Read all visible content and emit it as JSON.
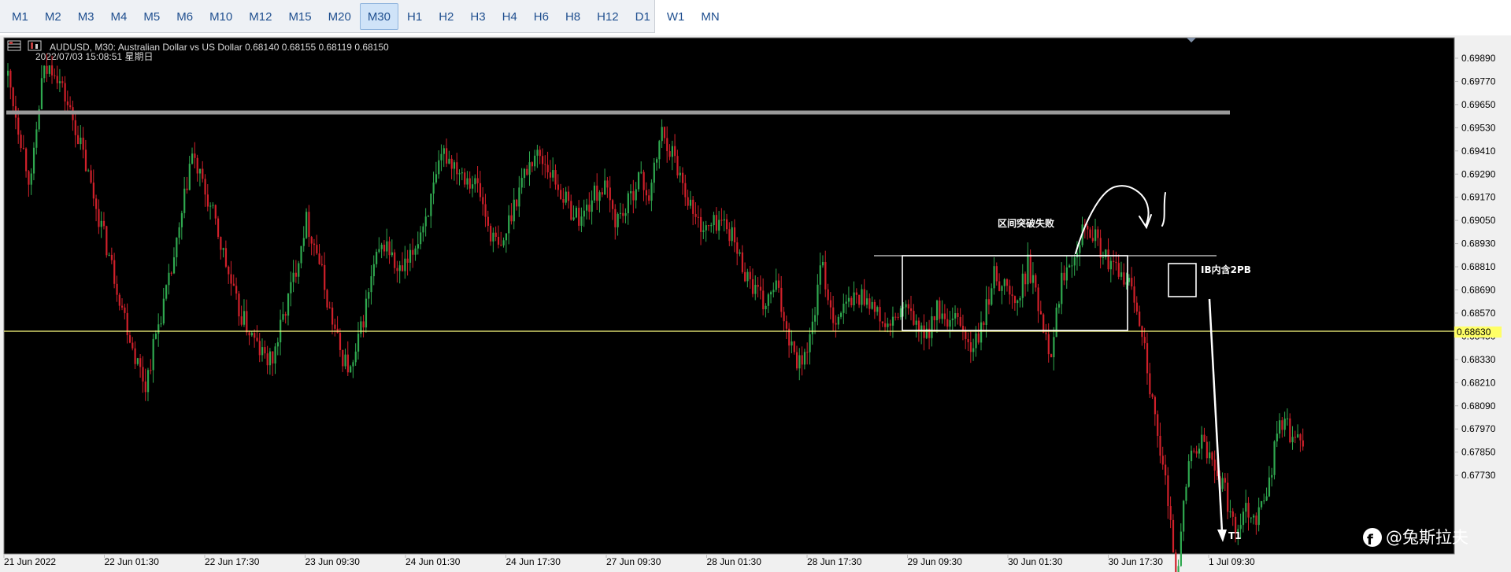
{
  "toolbar": {
    "timeframes": [
      "M1",
      "M2",
      "M3",
      "M4",
      "M5",
      "M6",
      "M10",
      "M12",
      "M15",
      "M20",
      "M30",
      "H1",
      "H2",
      "H3",
      "H4",
      "H6",
      "H8",
      "H12",
      "D1",
      "W1",
      "MN"
    ],
    "active": "M30"
  },
  "chart_header": {
    "symbol_line": "AUDUSD, M30:  Australian Dollar vs US Dollar  0.68140 0.68155 0.68119 0.68150",
    "timestamp": "2022/07/03 15:08:51 星期日"
  },
  "price_axis": {
    "labels": [
      "0.69890",
      "0.69770",
      "0.69650",
      "0.69530",
      "0.69410",
      "0.69290",
      "0.69170",
      "0.69050",
      "0.68930",
      "0.68810",
      "0.68690",
      "0.68570",
      "0.68450",
      "0.68330",
      "0.68210",
      "0.68090",
      "0.67970",
      "0.67850",
      "0.67730"
    ],
    "current_price": "0.68630"
  },
  "time_axis": {
    "labels": [
      "21 Jun 2022",
      "22 Jun 01:30",
      "22 Jun 17:30",
      "23 Jun 09:30",
      "24 Jun 01:30",
      "24 Jun 17:30",
      "27 Jun 09:30",
      "28 Jun 01:30",
      "28 Jun 17:30",
      "29 Jun 09:30",
      "30 Jun 01:30",
      "30 Jun 17:30",
      "1 Jul 09:30"
    ]
  },
  "annotations": {
    "range_break_fail": "区间突破失败",
    "ib_label": "IB内含2PB",
    "target": "T1"
  },
  "watermark": {
    "text": "@兔斯拉夫"
  },
  "colors": {
    "background": "#000000",
    "bull": "#2fa84f",
    "bear": "#d0202a",
    "price_line": "#ffff80",
    "resistance": "#9a9a9a"
  },
  "chart_data": {
    "type": "candlestick",
    "symbol": "AUDUSD",
    "timeframe": "M30",
    "ylim": [
      0.677,
      0.6999
    ],
    "path": [
      0.6985,
      0.696,
      0.6935,
      0.6985,
      0.699,
      0.6975,
      0.696,
      0.694,
      0.692,
      0.69,
      0.688,
      0.686,
      0.6845,
      0.687,
      0.689,
      0.6915,
      0.695,
      0.6935,
      0.692,
      0.69,
      0.688,
      0.687,
      0.686,
      0.6855,
      0.6875,
      0.6895,
      0.692,
      0.6905,
      0.688,
      0.686,
      0.685,
      0.6875,
      0.69,
      0.691,
      0.6895,
      0.69,
      0.6915,
      0.693,
      0.695,
      0.6945,
      0.694,
      0.6935,
      0.6915,
      0.6905,
      0.6925,
      0.694,
      0.695,
      0.6945,
      0.6935,
      0.6925,
      0.692,
      0.693,
      0.6935,
      0.692,
      0.6925,
      0.694,
      0.693,
      0.696,
      0.695,
      0.6935,
      0.692,
      0.6915,
      0.692,
      0.6915,
      0.69,
      0.689,
      0.688,
      0.689,
      0.687,
      0.6855,
      0.6865,
      0.69,
      0.6875,
      0.688,
      0.6885,
      0.6885,
      0.6875,
      0.687,
      0.688,
      0.6875,
      0.6865,
      0.688,
      0.687,
      0.6875,
      0.686,
      0.687,
      0.6895,
      0.689,
      0.688,
      0.69,
      0.688,
      0.686,
      0.6895,
      0.6905,
      0.692,
      0.691,
      0.69,
      0.6895,
      0.689,
      0.687,
      0.683,
      0.68,
      0.676,
      0.681,
      0.682,
      0.681,
      0.68,
      0.678,
      0.679,
      0.6785,
      0.68,
      0.683,
      0.6823,
      0.6815
    ]
  }
}
